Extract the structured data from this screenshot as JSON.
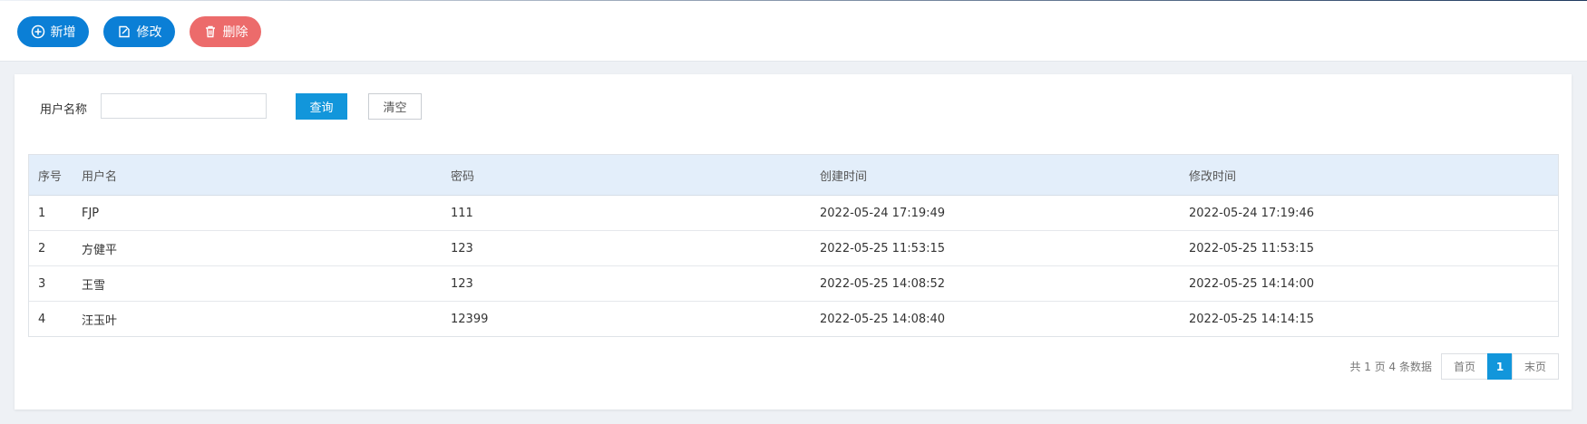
{
  "toolbar": {
    "add_label": "新增",
    "edit_label": "修改",
    "delete_label": "删除"
  },
  "search": {
    "label": "用户名称",
    "value": "",
    "query_label": "查询",
    "clear_label": "清空"
  },
  "table": {
    "headers": [
      "序号",
      "用户名",
      "密码",
      "创建时间",
      "修改时间"
    ],
    "rows": [
      [
        "1",
        "FJP",
        "111",
        "2022-05-24 17:19:49",
        "2022-05-24 17:19:46"
      ],
      [
        "2",
        "方健平",
        "123",
        "2022-05-25 11:53:15",
        "2022-05-25 11:53:15"
      ],
      [
        "3",
        "王雪",
        "123",
        "2022-05-25 14:08:52",
        "2022-05-25 14:14:00"
      ],
      [
        "4",
        "汪玉叶",
        "12399",
        "2022-05-25 14:08:40",
        "2022-05-25 14:14:15"
      ]
    ]
  },
  "pager": {
    "info": "共 1 页 4 条数据",
    "first_label": "首页",
    "current_page": "1",
    "last_label": "末页"
  },
  "colors": {
    "primary": "#0b7fd6",
    "query": "#1296db",
    "danger": "#ec6b6b",
    "header_bg": "#e3eefa"
  }
}
